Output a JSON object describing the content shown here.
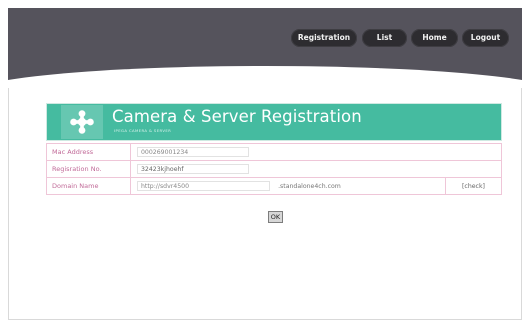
{
  "nav": {
    "registration": "Registration",
    "list": "List",
    "home": "Home",
    "logout": "Logout"
  },
  "banner": {
    "title": "Camera & Server Registration",
    "subtitle": "IPEGA CAMERA & SERVER"
  },
  "form": {
    "mac_label": "Mac Address",
    "mac_value": "000269001234",
    "reg_label": "Regisration No.",
    "reg_value": "32423kjhoehf",
    "domain_label": "Domain Name",
    "domain_value": "http://sdvr4500",
    "domain_suffix": ".standalone4ch.com",
    "check_label": "[check]"
  },
  "ok_label": "OK",
  "colors": {
    "header_bar": "#55535c",
    "nav_pill": "#2d2c30",
    "banner": "#45bba0",
    "label_text": "#c16a98",
    "table_border": "#efc6d8"
  },
  "icons": {
    "logo": "plus-flower-logo"
  }
}
